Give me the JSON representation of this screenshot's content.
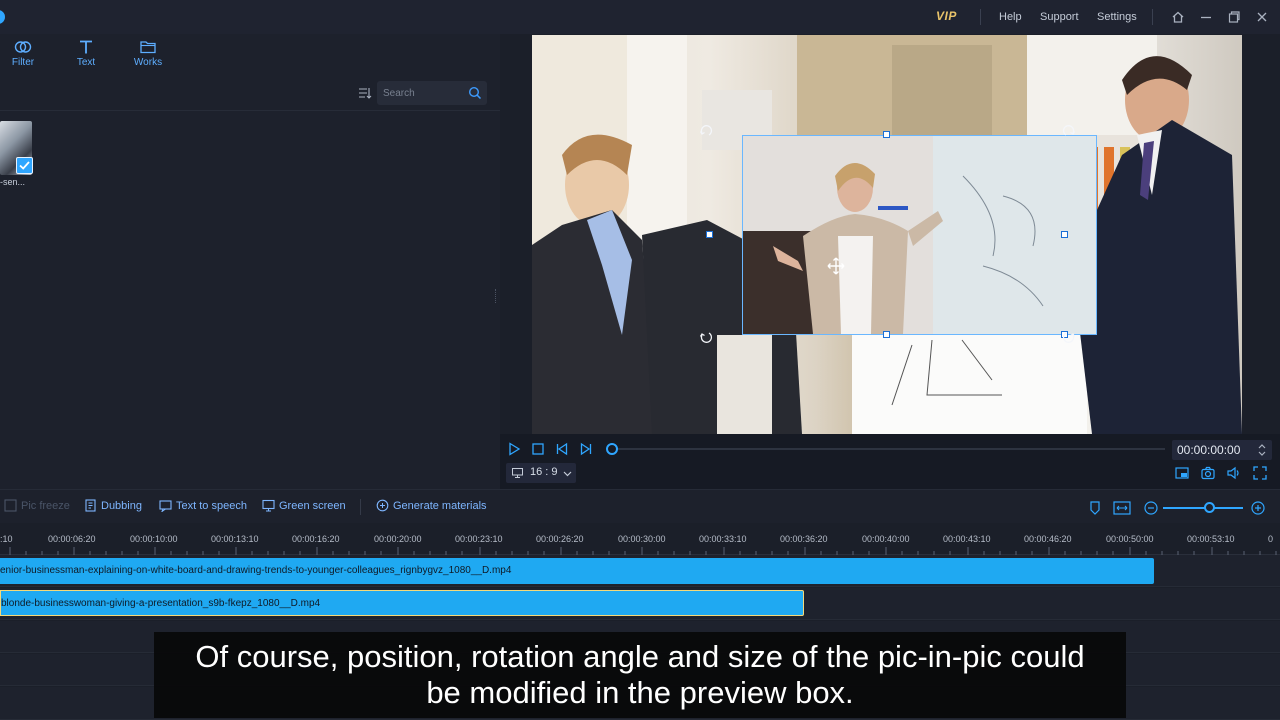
{
  "titlebar": {
    "vip_label": "VIP",
    "help_label": "Help",
    "support_label": "Support",
    "settings_label": "Settings",
    "icons": [
      "home-icon",
      "minimize-icon",
      "restore-icon",
      "close-icon"
    ]
  },
  "left_panel": {
    "tabs": [
      {
        "label": "Filter",
        "icon": "filter-rings-icon"
      },
      {
        "label": "Text",
        "icon": "text-t-icon"
      },
      {
        "label": "Works",
        "icon": "folder-icon"
      }
    ],
    "search": {
      "placeholder": "Search",
      "value": ""
    },
    "media_items": [
      {
        "label": "-sen...",
        "selected": true
      }
    ]
  },
  "preview": {
    "timecode": "00:00:00:00",
    "aspect_ratio": "16 : 9",
    "progress": 0,
    "controls": [
      "play-icon",
      "stop-icon",
      "previous-frame-icon",
      "next-frame-icon"
    ],
    "right_controls": [
      "pip-icon",
      "snapshot-icon",
      "volume-icon",
      "fullscreen-icon"
    ]
  },
  "timeline_toolbar": {
    "buttons": [
      {
        "label": "Pic freeze",
        "icon": "freeze-icon",
        "enabled": false
      },
      {
        "label": "Dubbing",
        "icon": "dubbing-icon",
        "enabled": true
      },
      {
        "label": "Text to speech",
        "icon": "text-to-speech-icon",
        "enabled": true
      },
      {
        "label": "Green screen",
        "icon": "green-screen-icon",
        "enabled": true
      },
      {
        "label": "Generate materials",
        "icon": "generate-materials-icon",
        "enabled": true
      }
    ],
    "zoom_level": 0.55
  },
  "ruler": {
    "labels": [
      "00:00:06:20",
      "00:00:10:00",
      "00:00:13:10",
      "00:00:16:20",
      "00:00:20:00",
      "00:00:23:10",
      "00:00:26:20",
      "00:00:30:00",
      "00:00:33:10",
      "00:00:36:20",
      "00:00:40:00",
      "00:00:43:10",
      "00:00:46:20",
      "00:00:50:00",
      "00:00:53:10"
    ],
    "first_label": ":10"
  },
  "tracks": [
    {
      "clip_name": "enior-businessman-explaining-on-white-board-and-drawing-trends-to-younger-colleagues_rignbygvz_1080__D.mp4",
      "selected": false
    },
    {
      "clip_name": "blonde-businesswoman-giving-a-presentation_s9b-fkepz_1080__D.mp4",
      "selected": true
    }
  ],
  "caption": {
    "line1": "Of course, position, rotation angle and size of the pic-in-pic could",
    "line2": "be modified in the preview box."
  },
  "colors": {
    "accent": "#2fa6ff",
    "clip": "#1fa9f2",
    "vip": "#e8c36a",
    "selection_border": "#f3d97a"
  }
}
